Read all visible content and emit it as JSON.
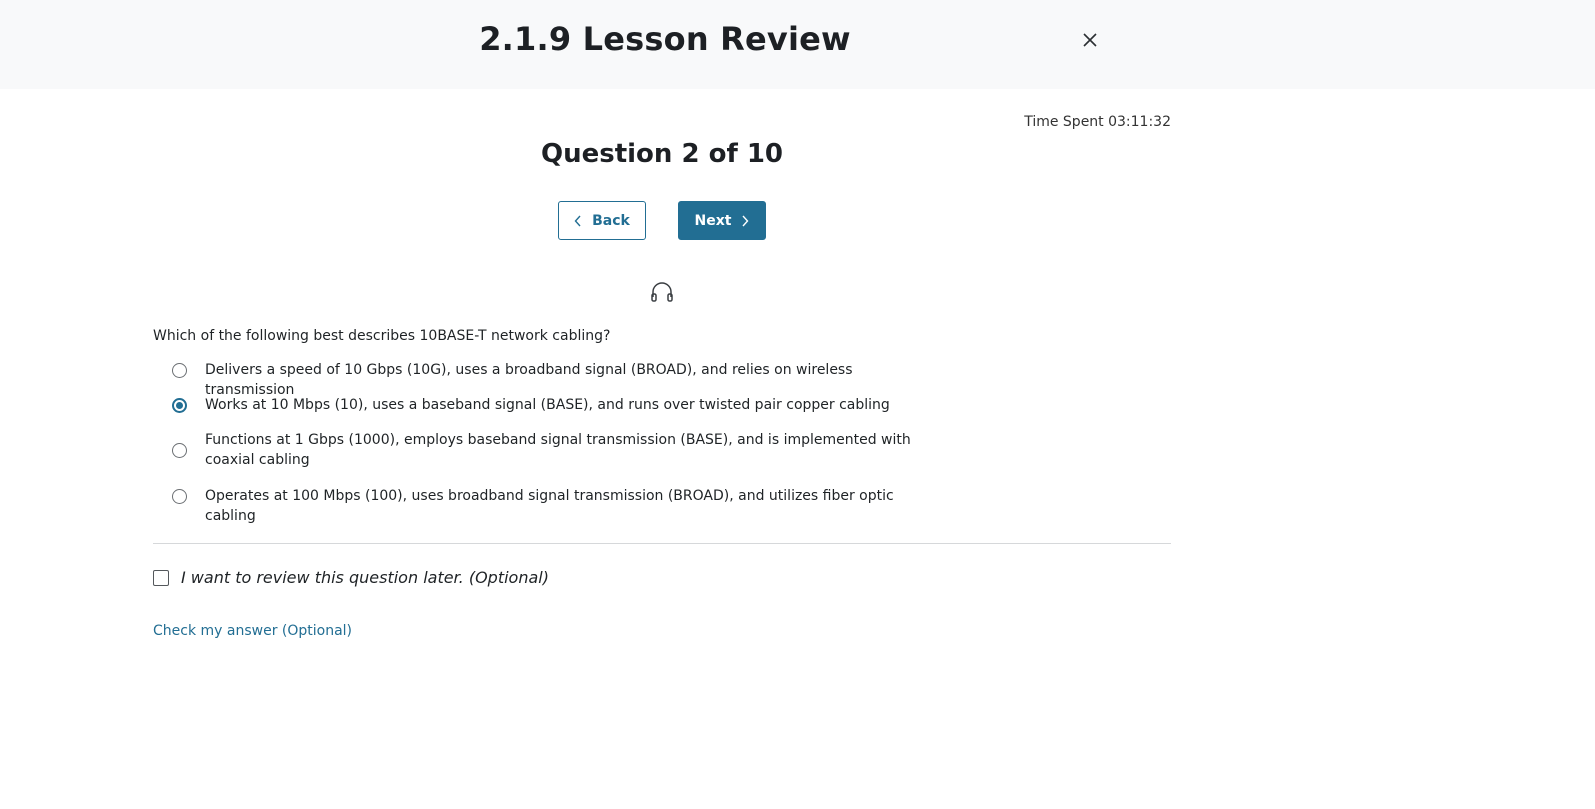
{
  "header": {
    "title": "2.1.9 Lesson Review",
    "close_icon": "close-icon"
  },
  "time_spent": {
    "label": "Time Spent 03:11:32"
  },
  "question": {
    "title": "Question 2 of 10",
    "back_label": "Back",
    "next_label": "Next",
    "audio_icon": "headphones-icon",
    "prompt": "Which of the following best describes 10BASE-T network cabling?",
    "options": [
      {
        "label": "Delivers a speed of 10 Gbps (10G), uses a broadband signal (BROAD), and relies on wireless transmission",
        "selected": false
      },
      {
        "label": "Works at 10 Mbps (10), uses a baseband signal (BASE), and runs over twisted pair copper cabling",
        "selected": true
      },
      {
        "label": "Functions at 1 Gbps (1000), employs baseband signal transmission (BASE), and is implemented with coaxial cabling",
        "selected": false
      },
      {
        "label": "Operates at 100 Mbps (100), uses broadband signal transmission (BROAD), and utilizes fiber optic cabling",
        "selected": false
      }
    ]
  },
  "review": {
    "label": "I want to review this question later. (Optional)",
    "checked": false
  },
  "check_answer": {
    "label": "Check my answer (Optional)"
  },
  "colors": {
    "accent": "#226e93",
    "header_bg": "#f8f9fa"
  }
}
